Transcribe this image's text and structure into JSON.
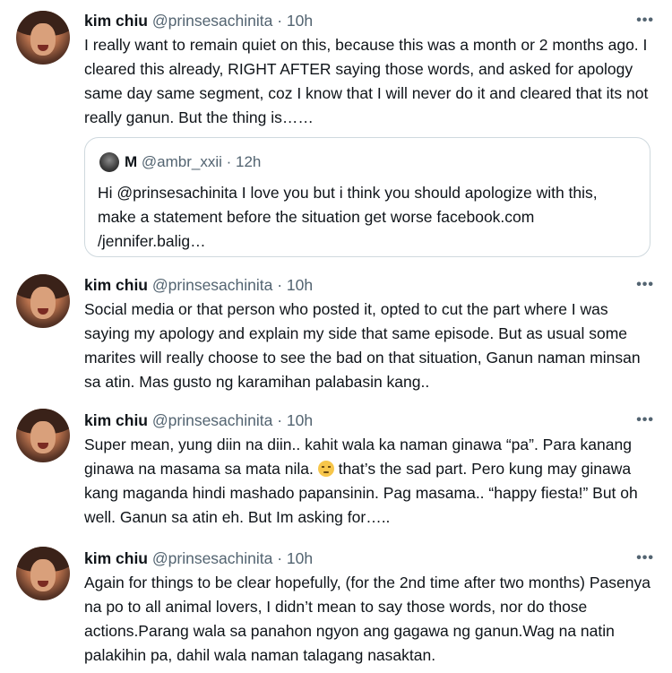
{
  "tweets": [
    {
      "name": "kim chiu",
      "handle": "@prinsesachinita · 10h",
      "more": "•••",
      "text": "I really want to remain quiet on this, because this was a month or 2 months ago. I cleared this already, RIGHT AFTER saying those words, and asked for apology same day same segment, coz I know that I will never do it and cleared that its not really ganun. But the thing is……",
      "quote": {
        "name": "M",
        "handle": "@ambr_xxii · 12h",
        "text": "Hi @prinsesachinita I love you but i think you should apologize with this, make a statement before the situation get worse facebook.com /jennifer.balig…"
      }
    },
    {
      "name": "kim chiu",
      "handle": "@prinsesachinita · 10h",
      "more": "•••",
      "text": "Social media or that person who posted it, opted to cut the part where I was saying my apology and explain my side that same episode. But as usual some marites will really choose to see the bad on that situation, Ganun naman minsan sa atin. Mas gusto ng karamihan palabasin kang.."
    },
    {
      "name": "kim chiu",
      "handle": "@prinsesachinita · 10h",
      "more": "•••",
      "text_before_emoji": "Super mean, yung diin na diin.. kahit wala ka naman ginawa “pa”. Para kanang ginawa na masama sa mata nila.",
      "emoji": "pensive-face-emoji",
      "text_after_emoji": "that’s the sad part. Pero kung may ginawa kang maganda hindi mashado papansinin. Pag masama.. “happy fiesta!” But oh well. Ganun sa atin eh. But Im asking for….."
    },
    {
      "name": "kim chiu",
      "handle": "@prinsesachinita · 10h",
      "more": "•••",
      "text": "Again for things to be clear hopefully, (for the 2nd time after two months) Pasenya na po to all animal lovers, I didn’t mean to say those words, nor do those actions.Parang wala sa panahon ngyon ang gagawa ng ganun.Wag na natin palakihin pa, dahil wala naman talagang nasaktan."
    }
  ]
}
